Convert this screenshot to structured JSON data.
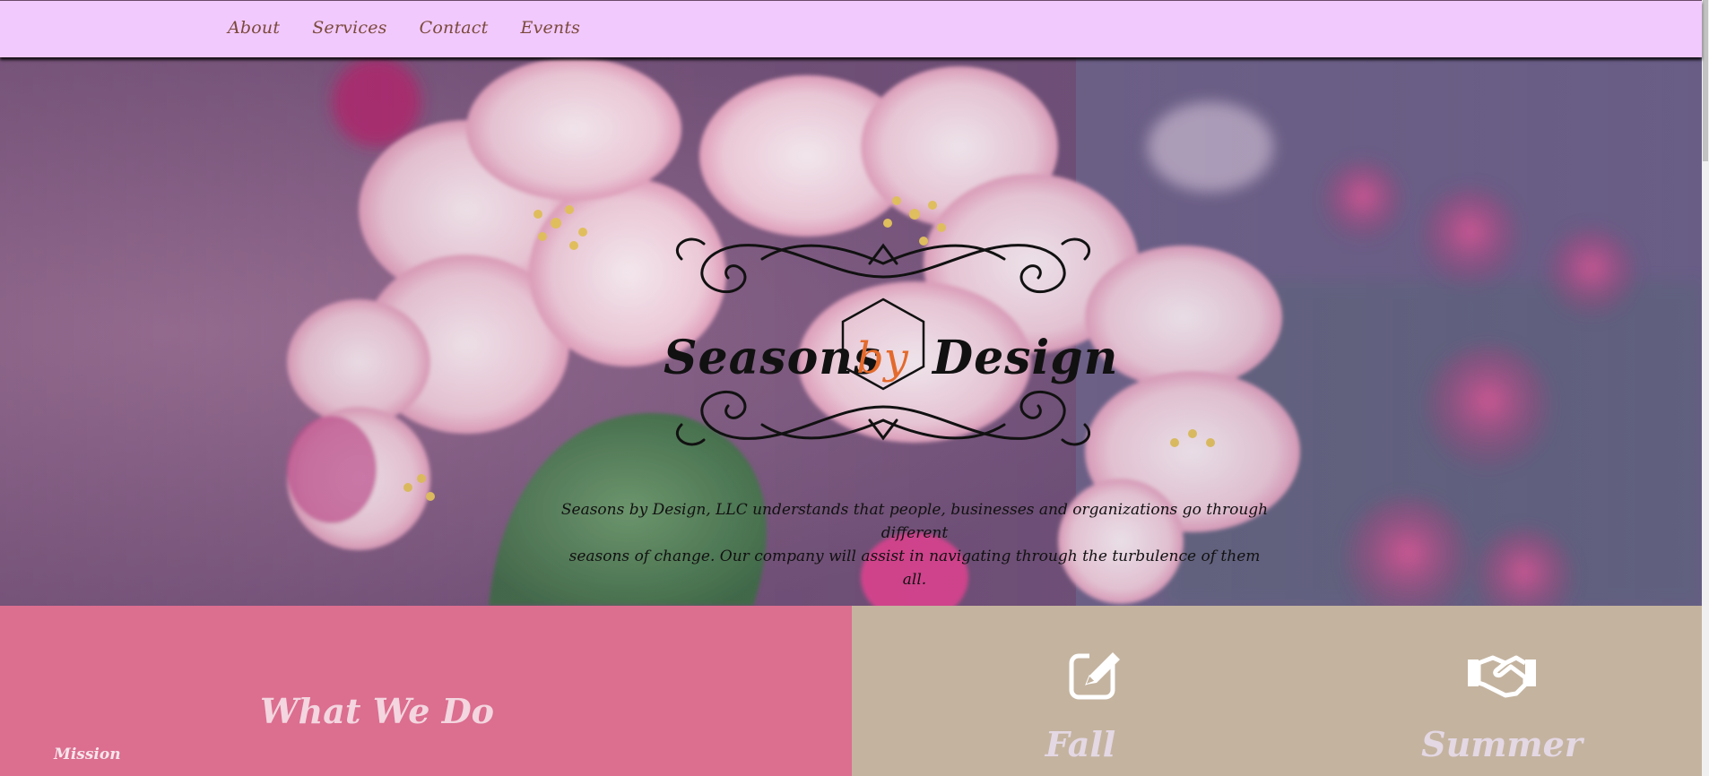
{
  "nav": {
    "items": [
      {
        "label": "About"
      },
      {
        "label": "Services"
      },
      {
        "label": "Contact"
      },
      {
        "label": "Events"
      }
    ]
  },
  "hero": {
    "logo": {
      "word_left": "Seasons",
      "word_middle": "by",
      "word_right": "Design"
    },
    "tagline_line1": "Seasons by Design, LLC understands that people, businesses and organizations go through different",
    "tagline_line2": "seasons of change. Our company will assist in navigating through the turbulence of them all."
  },
  "what_we_do": {
    "title": "What We Do",
    "mission_label": "Mission"
  },
  "seasons": {
    "items": [
      {
        "title": "Fall",
        "icon": "edit-icon"
      },
      {
        "title": "Summer",
        "icon": "handshake-icon"
      }
    ]
  },
  "colors": {
    "nav_bg": "#f2c9fd",
    "nav_text": "#7a4a3c",
    "pink_panel": "#dc6e90",
    "tan_panel": "#c4b39f",
    "logo_accent": "#e36a2c"
  }
}
